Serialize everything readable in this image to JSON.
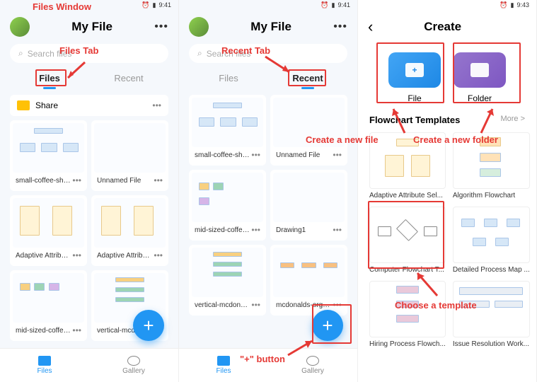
{
  "status_time": "9:41",
  "status_time_3": "9:43",
  "panel1": {
    "title": "My File",
    "search_ph": "Search files",
    "tab_files": "Files",
    "tab_recent": "Recent",
    "share": "Share",
    "files": [
      "small-coffee-shop-...",
      "Unnamed File",
      "Adaptive Attribute ...",
      "Adaptive Attribute ...",
      "mid-sized-coffee-s...",
      "vertical-mcdonal..."
    ],
    "nav_files": "Files",
    "nav_gallery": "Gallery"
  },
  "panel2": {
    "title": "My File",
    "search_ph": "Search files",
    "tab_files": "Files",
    "tab_recent": "Recent",
    "files": [
      "small-coffee-shop-...",
      "Unnamed File",
      "mid-sized-coffee-s...",
      "Drawing1",
      "vertical-mcdonald...",
      "mcdonalds-organi..."
    ]
  },
  "panel3": {
    "title": "Create",
    "btn_file": "File",
    "btn_folder": "Folder",
    "section": "Flowchart Templates",
    "more": "More  >",
    "tpls": [
      "Adaptive Attribute Sel...",
      "Algorithm Flowchart",
      "Computer Flowchart T...",
      "Detailed Process Map ...",
      "Hiring Process Flowch...",
      "Issue Resolution Work..."
    ]
  },
  "ann": {
    "files_window": "Files Window",
    "files_tab": "Files Tab",
    "recent_tab": "Recent Tab",
    "plus_button": "\"+\" button",
    "new_file": "Create a new file",
    "new_folder": "Create a new folder",
    "choose_tpl": "Choose a template"
  }
}
